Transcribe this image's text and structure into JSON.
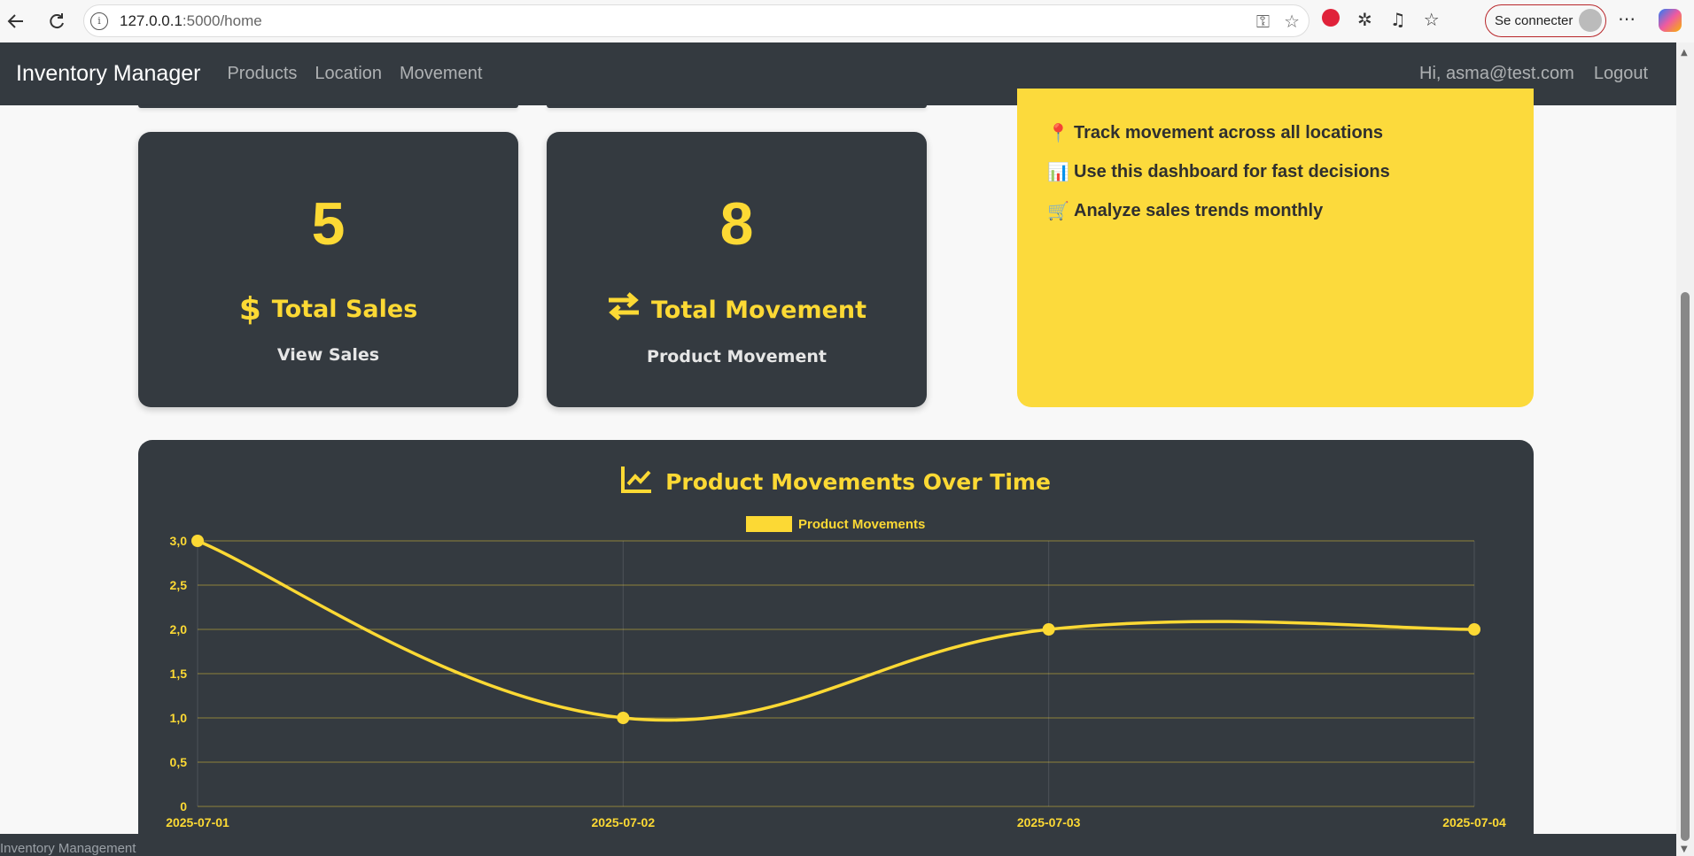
{
  "browser": {
    "url_host": "127.0.0.1",
    "url_path": ":5000/home",
    "signin_label": "Se connecter"
  },
  "navbar": {
    "brand": "Inventory Manager",
    "links": [
      "Products",
      "Location",
      "Movement"
    ],
    "greeting": "Hi, asma@test.com",
    "logout": "Logout"
  },
  "stats": [
    {
      "value": "5",
      "title": "Total Sales",
      "subtitle": "View Sales",
      "icon": "dollar-icon"
    },
    {
      "value": "8",
      "title": "Total Movement",
      "subtitle": "Product Movement",
      "icon": "exchange-icon"
    }
  ],
  "tips": [
    {
      "emoji": "📍",
      "text": "Track movement across all locations"
    },
    {
      "emoji": "📊",
      "text": "Use this dashboard for fast decisions"
    },
    {
      "emoji": "🛒",
      "text": "Analyze sales trends monthly"
    }
  ],
  "chart_title": "Product Movements Over Time",
  "chart_data": {
    "type": "line",
    "title": "Product Movements Over Time",
    "x": [
      "2025-07-01",
      "2025-07-02",
      "2025-07-03",
      "2025-07-04"
    ],
    "series": [
      {
        "name": "Product Movements",
        "values": [
          3,
          1,
          2,
          2
        ]
      }
    ],
    "ylim": [
      0,
      3
    ],
    "yticks": [
      "0",
      "0,5",
      "1,0",
      "1,5",
      "2,0",
      "2,5",
      "3,0"
    ],
    "grid": true,
    "legend": "top",
    "color": "#fcd934"
  },
  "footer": "Inventory Management",
  "colors": {
    "accent": "#fcd934",
    "dark": "#343a40",
    "tips_bg": "#fcda3c"
  }
}
